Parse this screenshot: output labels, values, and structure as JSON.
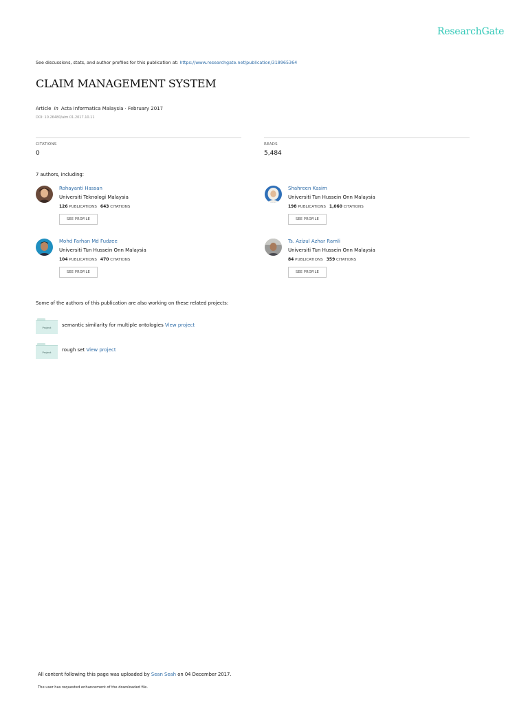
{
  "brand": "ResearchGate",
  "see_line": {
    "prefix": "See discussions, stats, and author profiles for this publication at: ",
    "url": "https://www.researchgate.net/publication/318965364"
  },
  "title": "CLAIM MANAGEMENT SYSTEM",
  "meta": {
    "type": "Article",
    "in": "in",
    "journal": "Acta Informatica Malaysia · February 2017",
    "doi": "DOI: 10.26480/aim.01.2017.10.11"
  },
  "stats": {
    "citations_label": "CITATIONS",
    "citations_value": "0",
    "reads_label": "READS",
    "reads_value": "5,484"
  },
  "authors_heading": "7 authors, including:",
  "authors": [
    {
      "name": "Rohayanti Hassan",
      "institution": "Universiti Teknologi Malaysia",
      "publications": "126",
      "publications_label": "PUBLICATIONS",
      "citations": "643",
      "citations_label": "CITATIONS",
      "button": "SEE PROFILE"
    },
    {
      "name": "Shahreen Kasim",
      "institution": "Universiti Tun Hussein Onn Malaysia",
      "publications": "198",
      "publications_label": "PUBLICATIONS",
      "citations": "1,060",
      "citations_label": "CITATIONS",
      "button": "SEE PROFILE"
    },
    {
      "name": "Mohd Farhan Md Fudzee",
      "institution": "Universiti Tun Hussein Onn Malaysia",
      "publications": "104",
      "publications_label": "PUBLICATIONS",
      "citations": "470",
      "citations_label": "CITATIONS",
      "button": "SEE PROFILE"
    },
    {
      "name": "Ts. Azizul Azhar Ramli",
      "institution": "Universiti Tun Hussein Onn Malaysia",
      "publications": "84",
      "publications_label": "PUBLICATIONS",
      "citations": "359",
      "citations_label": "CITATIONS",
      "button": "SEE PROFILE"
    }
  ],
  "related_heading": "Some of the authors of this publication are also working on these related projects:",
  "projects": [
    {
      "icon_label": "Project",
      "text": "semantic similarity for multiple ontologies",
      "link": "View project"
    },
    {
      "icon_label": "Project",
      "text": "rough set",
      "link": "View project"
    }
  ],
  "footer": {
    "prefix": "All content following this page was uploaded by ",
    "uploader": "Sean Seah",
    "suffix": " on 04 December 2017.",
    "note": "The user has requested enhancement of the downloaded file."
  },
  "colors": {
    "brand": "#2fc7b6",
    "link": "#2b6aa6"
  },
  "icons": {
    "project": "folder-icon",
    "avatar": "avatar-photo"
  }
}
